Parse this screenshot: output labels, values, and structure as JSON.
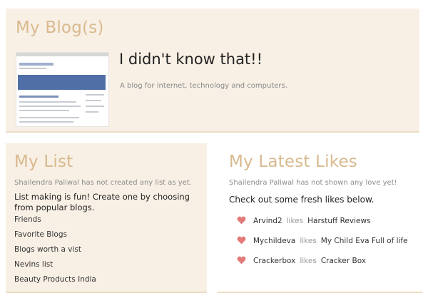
{
  "my_blogs": {
    "title": "My Blog(s)",
    "blog": {
      "name": "I didn't know that!!",
      "description": "A blog for internet, technology and computers."
    }
  },
  "my_list": {
    "title": "My List",
    "status": "Shailendra Paliwal has not created any list as yet.",
    "cta": "List making is fun! Create one by choosing from popular blogs.",
    "items": [
      "Friends",
      "Favorite Blogs",
      "Blogs worth a vist",
      "Nevins list",
      "Beauty Products India"
    ]
  },
  "latest_likes": {
    "title": "My Latest Likes",
    "status": "Shailendra Paliwal has not shown any love yet!",
    "cta": "Check out some fresh likes below.",
    "verb": "likes",
    "heart_color": "#e27a7a",
    "items": [
      {
        "user": "Arvind2",
        "blog": "Harstuff Reviews"
      },
      {
        "user": "Mychildeva",
        "blog": "My Child Eva Full of life"
      },
      {
        "user": "Crackerbox",
        "blog": "Cracker Box"
      }
    ]
  },
  "colors": {
    "panel_bg": "#f8f0e5",
    "heading": "#d9b98e",
    "panel_border": "#efdcc6"
  }
}
